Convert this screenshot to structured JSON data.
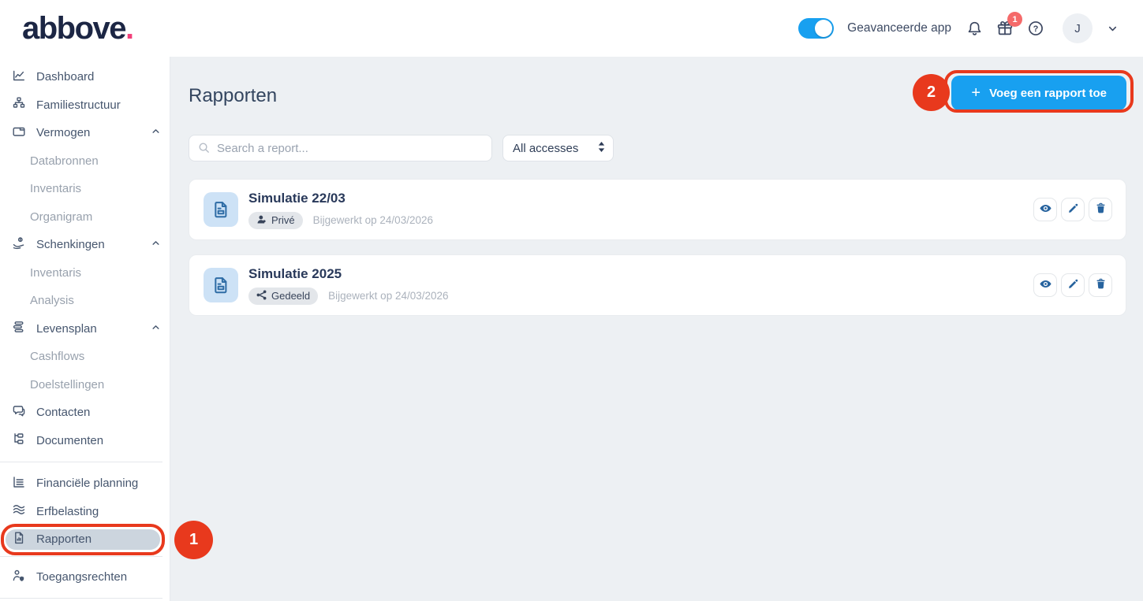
{
  "header": {
    "logo_text": "abbove",
    "logo_dot": ".",
    "toggle_label": "Geavanceerde app",
    "gift_badge_count": "1",
    "avatar_initial": "J"
  },
  "sidebar": {
    "items": [
      {
        "label": "Dashboard",
        "icon": "dashboard-chart-icon"
      },
      {
        "label": "Familiestructuur",
        "icon": "family-tree-icon"
      },
      {
        "label": "Vermogen",
        "icon": "wallet-icon",
        "expanded": true
      },
      {
        "label": "Databronnen",
        "sub": true
      },
      {
        "label": "Inventaris",
        "sub": true
      },
      {
        "label": "Organigram",
        "sub": true
      },
      {
        "label": "Schenkingen",
        "icon": "donation-icon",
        "expanded": true
      },
      {
        "label": "Inventaris",
        "sub": true
      },
      {
        "label": "Analysis",
        "sub": true
      },
      {
        "label": "Levensplan",
        "icon": "life-plan-icon",
        "expanded": true
      },
      {
        "label": "Cashflows",
        "sub": true
      },
      {
        "label": "Doelstellingen",
        "sub": true
      },
      {
        "label": "Contacten",
        "icon": "chat-bubbles-icon"
      },
      {
        "label": "Documenten",
        "icon": "document-tree-icon"
      },
      {
        "label": "Financiële planning",
        "icon": "financial-chart-icon"
      },
      {
        "label": "Erfbelasting",
        "icon": "layers-waves-icon"
      },
      {
        "label": "Rapporten",
        "icon": "report-document-icon",
        "active": true
      },
      {
        "label": "Toegangsrechten",
        "icon": "user-shield-icon"
      }
    ]
  },
  "main": {
    "title": "Rapporten",
    "search_placeholder": "Search a report...",
    "access_filter_value": "All accesses",
    "add_button_plus": "+",
    "add_button_label": "Voeg een rapport toe",
    "reports": [
      {
        "title": "Simulatie 22/03",
        "badge": "Privé",
        "badge_icon": "person-icon",
        "updated": "Bijgewerkt op 24/03/2026"
      },
      {
        "title": "Simulatie 2025",
        "badge": "Gedeeld",
        "badge_icon": "share-icon",
        "updated": "Bijgewerkt op 24/03/2026"
      }
    ]
  },
  "annotations": {
    "step_1": "1",
    "step_2": "2"
  },
  "colors": {
    "accent_blue": "#18a0f0",
    "annotation_red": "#e8391d",
    "notification_badge_red": "#f56a6a",
    "brand_navy": "#1c2644",
    "brand_pink": "#f23f79",
    "active_item_bg": "#ccd5de",
    "main_bg": "#edf0f3",
    "action_icon_blue": "#27639e",
    "doc_square_bg": "#cde2f6"
  }
}
